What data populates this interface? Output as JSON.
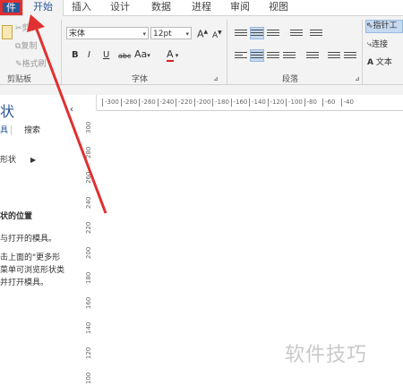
{
  "tabs": [
    {
      "label": "件",
      "id": "file"
    },
    {
      "label": "开始",
      "id": "home"
    },
    {
      "label": "插入",
      "id": "insert"
    },
    {
      "label": "设计",
      "id": "design"
    },
    {
      "label": "数据",
      "id": "data"
    },
    {
      "label": "进程",
      "id": "process"
    },
    {
      "label": "审阅",
      "id": "review"
    },
    {
      "label": "视图",
      "id": "view"
    }
  ],
  "clipboard": {
    "cut": "剪切",
    "copy": "复制",
    "format_painter": "格式刷",
    "group_label": "剪贴板"
  },
  "font": {
    "name": "宋体",
    "size": "12pt",
    "group_label": "字体",
    "grow": "A",
    "shrink": "A",
    "bold": "B",
    "italic": "I",
    "underline": "U",
    "strike": "abc",
    "case": "Aa",
    "color": "A"
  },
  "paragraph": {
    "group_label": "段落"
  },
  "tools": {
    "pointer": "指针工",
    "connector": "连接",
    "text": "文本",
    "text_icon": "A"
  },
  "shapes_panel": {
    "title": "状",
    "tab_shapes": "具",
    "tab_search": "搜索",
    "more_shapes": "形状",
    "heading": "状的位置",
    "line1": "与打开的模具。",
    "line2": "击上面的\"更多形",
    "line3": "菜单可浏览形状类",
    "line4": "并打开模具。"
  },
  "hruler_ticks": [
    "-300",
    "-280",
    "-260",
    "-240",
    "-220",
    "-200",
    "-180",
    "-160",
    "-140",
    "-120",
    "-100",
    "-80",
    "-60",
    "-40"
  ],
  "vruler_ticks": [
    "300",
    "280",
    "260",
    "240",
    "220",
    "200",
    "180",
    "160",
    "140",
    "120",
    "100"
  ],
  "watermark": "软件技巧",
  "colors": {
    "accent": "#2b5797",
    "annotation": "#e03030"
  }
}
